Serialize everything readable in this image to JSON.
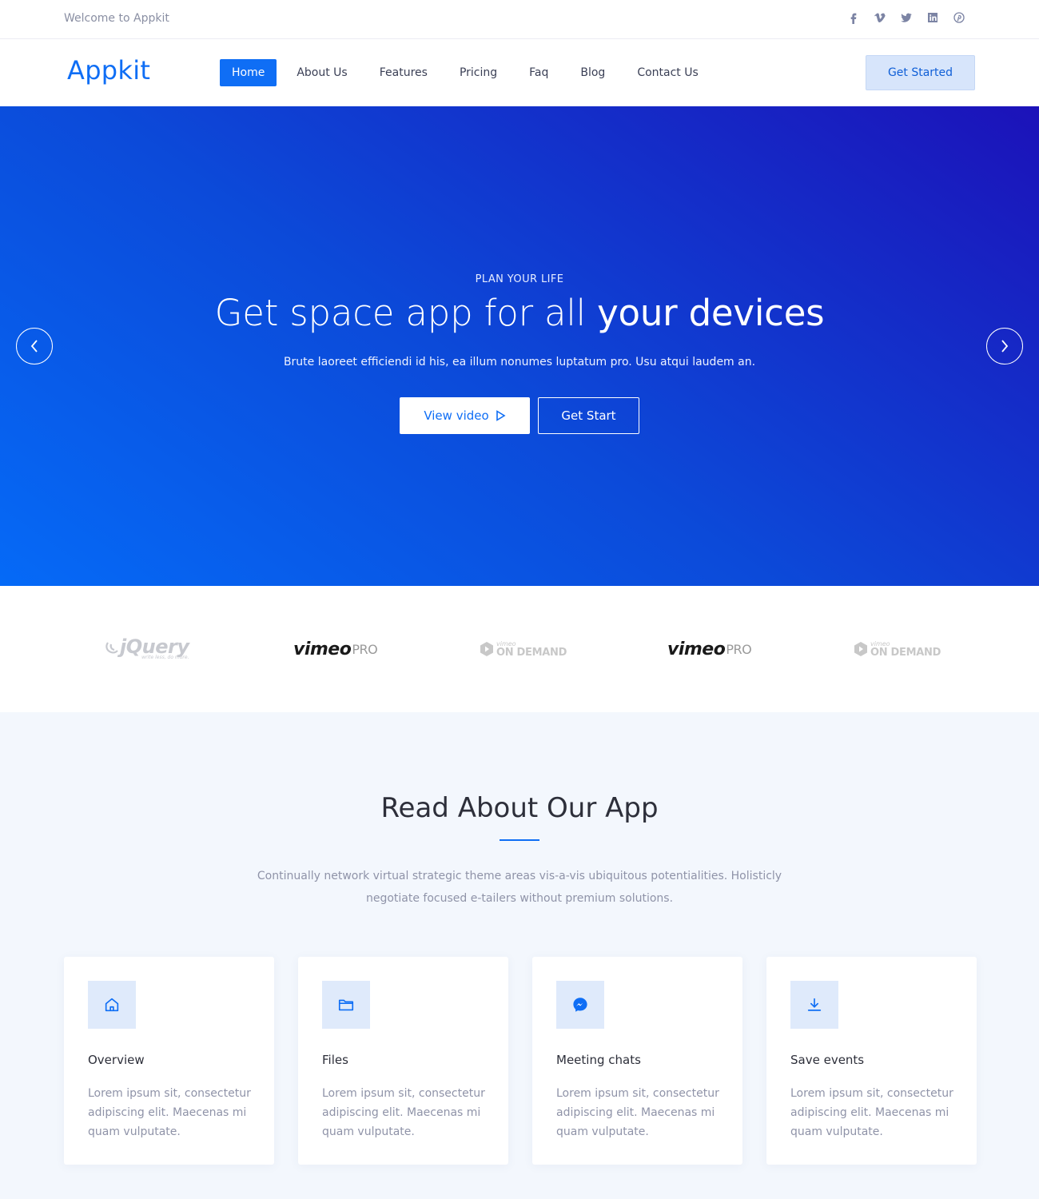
{
  "topbar": {
    "welcome": "Welcome to Appkit",
    "socials": [
      "facebook-icon",
      "vimeo-icon",
      "twitter-icon",
      "linkedin-icon",
      "pinterest-icon"
    ]
  },
  "navbar": {
    "logo": "Appkit",
    "items": [
      {
        "label": "Home",
        "active": true
      },
      {
        "label": "About Us"
      },
      {
        "label": "Features"
      },
      {
        "label": "Pricing"
      },
      {
        "label": "Faq"
      },
      {
        "label": "Blog"
      },
      {
        "label": "Contact Us"
      }
    ],
    "cta": "Get Started"
  },
  "hero": {
    "eyebrow": "PLAN YOUR LIFE",
    "title_light": "Get space app for all ",
    "title_strong": "your devices",
    "subtitle": "Brute laoreet efficiendi id his, ea illum nonumes luptatum pro. Usu atqui laudem an.",
    "primary_button": "View video",
    "secondary_button": "Get Start",
    "gradient": [
      "#056af7",
      "#1c12b9"
    ]
  },
  "brands": {
    "jquery": {
      "name": "jQuery",
      "tagline": "write less, do more."
    },
    "vimeo_pro": {
      "name": "vimeo",
      "suffix": "PRO"
    },
    "vimeo_on_demand": {
      "small": "vimeo",
      "name": "ON DEMAND"
    }
  },
  "about": {
    "title": "Read About Our App",
    "description": "Continually network virtual strategic theme areas vis-a-vis ubiquitous potentialities. Holisticly negotiate focused e-tailers without premium solutions.",
    "cards": [
      {
        "icon": "home-icon",
        "title": "Overview",
        "text": "Lorem ipsum sit, consectetur adipiscing elit. Maecenas mi quam vulputate."
      },
      {
        "icon": "folder-icon",
        "title": "Files",
        "text": "Lorem ipsum sit, consectetur adipiscing elit. Maecenas mi quam vulputate."
      },
      {
        "icon": "messenger-icon",
        "title": "Meeting chats",
        "text": "Lorem ipsum sit, consectetur adipiscing elit. Maecenas mi quam vulputate."
      },
      {
        "icon": "download-icon",
        "title": "Save events",
        "text": "Lorem ipsum sit, consectetur adipiscing elit. Maecenas mi quam vulputate."
      }
    ]
  },
  "colors": {
    "accent": "#0f6ef5",
    "muted_text": "#8f93a8",
    "section_bg": "#f3f7fd"
  }
}
